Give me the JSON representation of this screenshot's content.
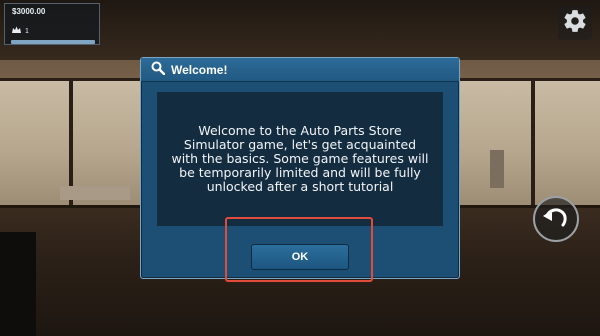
{
  "hud": {
    "money": "$3000.00",
    "level_icon": "crown-icon",
    "level": "1",
    "xp_progress": 1.0,
    "settings_icon": "gear-icon",
    "undo_icon": "undo-arrow-icon"
  },
  "dialog": {
    "title": "Welcome!",
    "title_icon": "magnifier-icon",
    "message": "Welcome to the Auto Parts Store Simulator game, let's get acquainted with the basics. Some game features will be temporarily limited and will be fully unlocked after a short tutorial",
    "ok_label": "OK"
  },
  "colors": {
    "dialog_bg": "#1d4e74",
    "dialog_body": "#142c40",
    "highlight": "#e04b3a"
  }
}
